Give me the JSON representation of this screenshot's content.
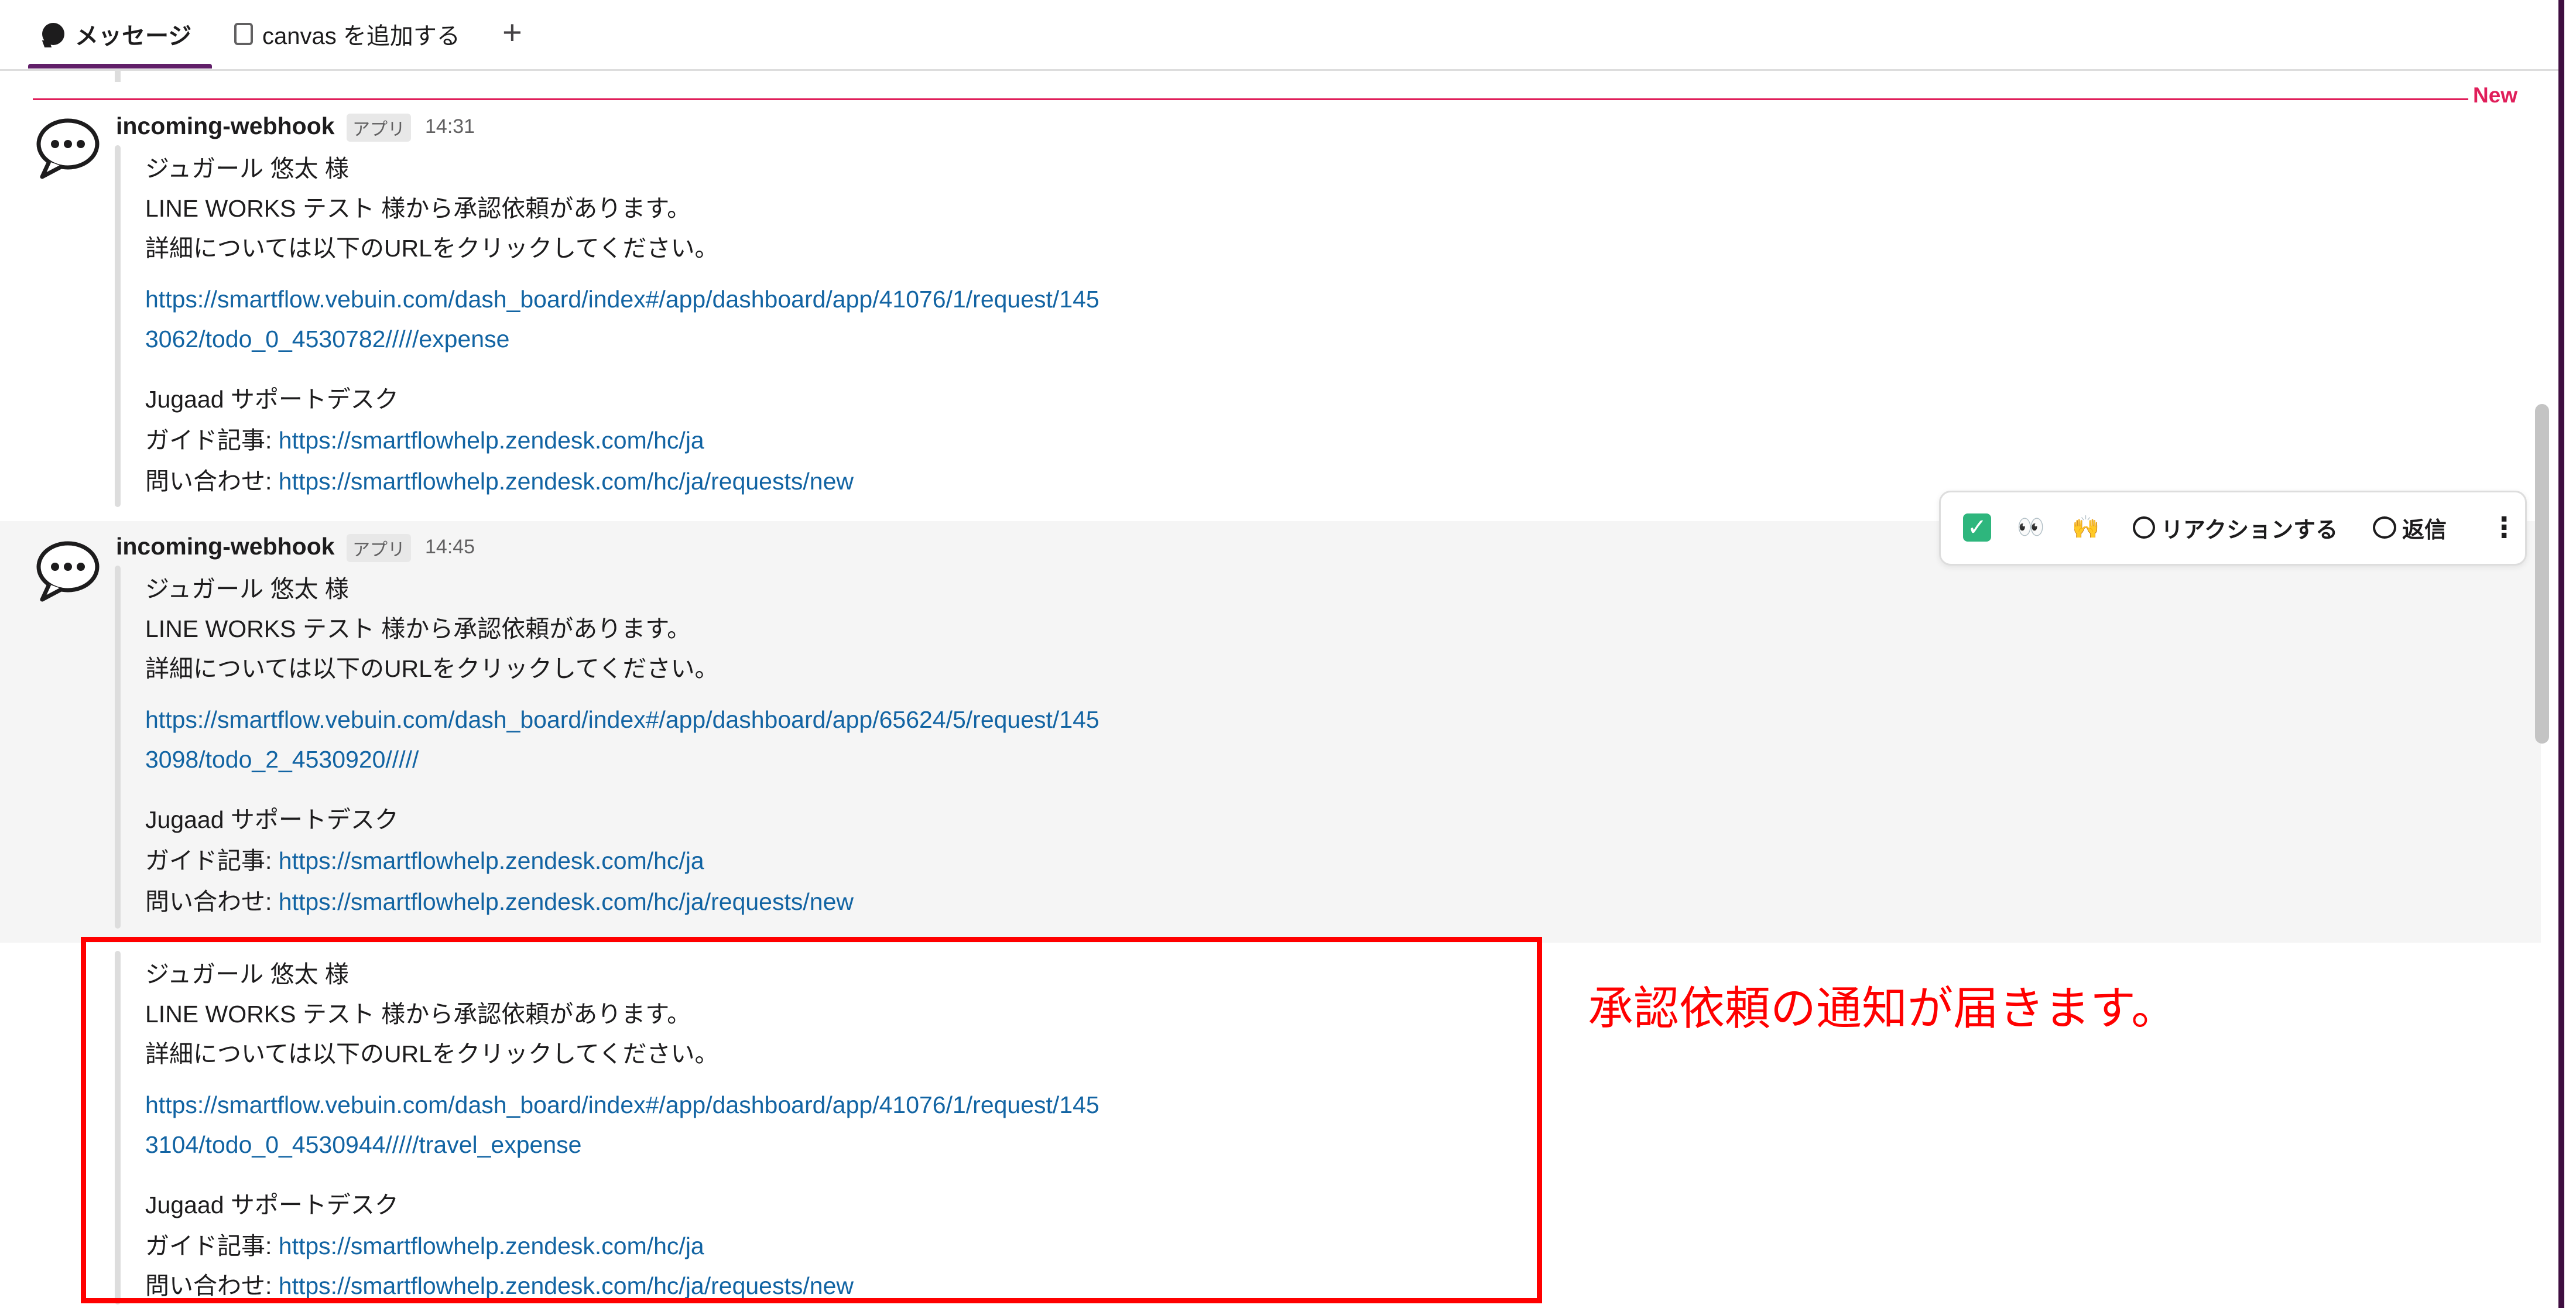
{
  "tabs": {
    "messages_label": "メッセージ",
    "canvas_label": "canvas を追加する",
    "add_label": "+"
  },
  "divider": {
    "new_label": "New"
  },
  "messages": [
    {
      "sender": "incoming-webhook",
      "badge": "アプリ",
      "time": "14:31",
      "lines": [
        "ジュガール 悠太 様",
        "LINE WORKS テスト 様から承認依頼があります。",
        "詳細については以下のURLをクリックしてください。"
      ],
      "url_line1": "https://smartflow.vebuin.com/dash_board/index#/app/dashboard/app/41076/1/request/145",
      "url_line2": "3062/todo_0_4530782/////expense",
      "desk": "Jugaad サポートデスク",
      "guide_label": "ガイド記事: ",
      "guide_url": "https://smartflowhelp.zendesk.com/hc/ja",
      "contact_label": "問い合わせ: ",
      "contact_url": "https://smartflowhelp.zendesk.com/hc/ja/requests/new"
    },
    {
      "sender": "incoming-webhook",
      "badge": "アプリ",
      "time": "14:45",
      "lines": [
        "ジュガール 悠太 様",
        "LINE WORKS テスト 様から承認依頼があります。",
        "詳細については以下のURLをクリックしてください。"
      ],
      "url_line1": "https://smartflow.vebuin.com/dash_board/index#/app/dashboard/app/65624/5/request/145",
      "url_line2": "3098/todo_2_4530920/////",
      "desk": "Jugaad サポートデスク",
      "guide_label": "ガイド記事: ",
      "guide_url": "https://smartflowhelp.zendesk.com/hc/ja",
      "contact_label": "問い合わせ: ",
      "contact_url": "https://smartflowhelp.zendesk.com/hc/ja/requests/new"
    },
    {
      "lines": [
        "ジュガール 悠太 様",
        "LINE WORKS テスト 様から承認依頼があります。",
        "詳細については以下のURLをクリックしてください。"
      ],
      "url_line1": "https://smartflow.vebuin.com/dash_board/index#/app/dashboard/app/41076/1/request/145",
      "url_line2": "3104/todo_0_4530944/////travel_expense",
      "desk": "Jugaad サポートデスク",
      "guide_label": "ガイド記事: ",
      "guide_url": "https://smartflowhelp.zendesk.com/hc/ja",
      "contact_label": "問い合わせ: ",
      "contact_url": "https://smartflowhelp.zendesk.com/hc/ja/requests/new"
    }
  ],
  "hover_actions": {
    "check_icon": "check-mark-emoji",
    "check_glyph": "✓",
    "eyes_icon": "eyes-emoji",
    "eyes_glyph": "👀",
    "raised_hands_icon": "raised-hands-emoji",
    "raised_hands_glyph": "🙌",
    "react_label": "リアクションする",
    "reply_label": "返信",
    "more_glyph": "⋮"
  },
  "annotation": "承認依頼の通知が届きます。",
  "colors": {
    "link": "#1264a3",
    "new_divider": "#e01e5a",
    "annotation": "#ff0000",
    "tab_underline": "#611f69"
  }
}
